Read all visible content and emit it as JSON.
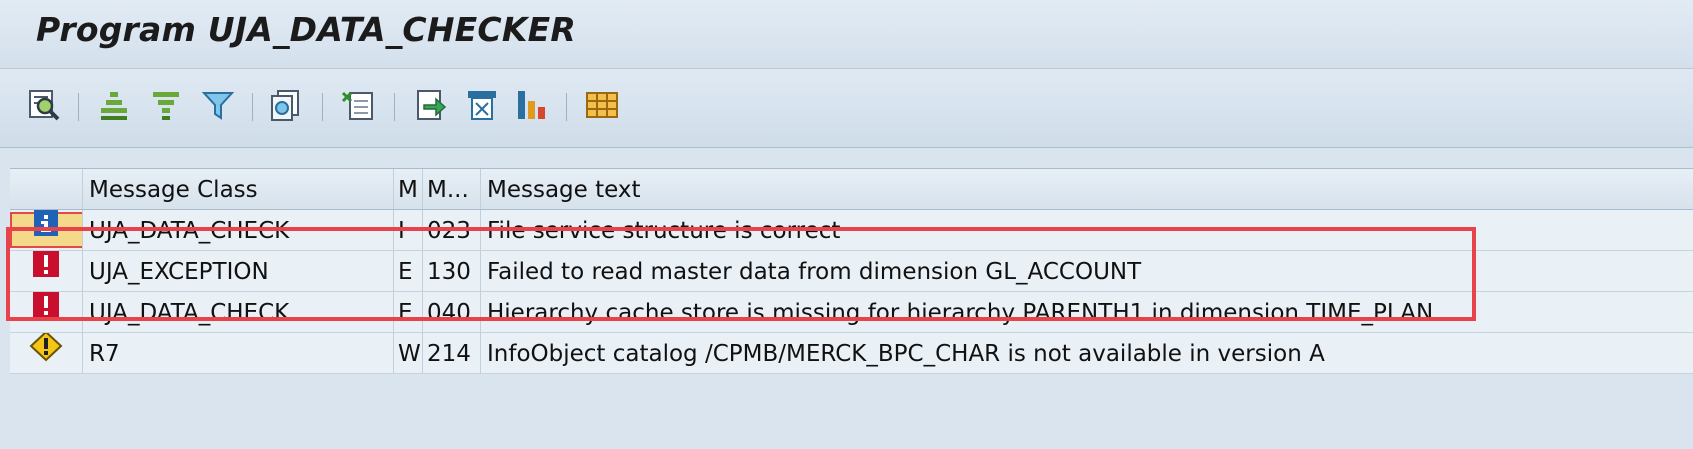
{
  "window": {
    "title": "Program UJA_DATA_CHECKER"
  },
  "toolbar": {
    "buttons": [
      {
        "icon": "detail-magnifier-icon"
      },
      {
        "icon": "sort-ascending-icon"
      },
      {
        "icon": "sort-descending-icon"
      },
      {
        "icon": "filter-icon"
      },
      {
        "icon": "print-preview-icon"
      },
      {
        "icon": "export-spreadsheet-icon"
      },
      {
        "icon": "export-file-icon"
      },
      {
        "icon": "select-layout-icon"
      },
      {
        "icon": "graphic-chart-icon"
      },
      {
        "icon": "change-layout-icon"
      }
    ]
  },
  "table": {
    "columns": [
      "",
      "Message Class",
      "M",
      "M...",
      "Message text"
    ],
    "rows": [
      {
        "type": "info",
        "icon": "info-icon",
        "message_class": "UJA_DATA_CHECK",
        "msg_type": "I",
        "msg_no": "023",
        "text": "File service structure is correct"
      },
      {
        "type": "error",
        "icon": "error-icon",
        "message_class": "UJA_EXCEPTION",
        "msg_type": "E",
        "msg_no": "130",
        "text": "Failed to read master data from dimension GL_ACCOUNT"
      },
      {
        "type": "error",
        "icon": "error-icon",
        "message_class": "UJA_DATA_CHECK",
        "msg_type": "E",
        "msg_no": "040",
        "text": "Hierarchy cache store is missing for hierarchy PARENTH1 in dimension TIME_PLAN"
      },
      {
        "type": "warning",
        "icon": "warning-icon",
        "message_class": "R7",
        "msg_type": "W",
        "msg_no": "214",
        "text": "InfoObject catalog /CPMB/MERCK_BPC_CHAR is not available in version A"
      }
    ]
  },
  "colors": {
    "error": "#c8102e",
    "warning": "#f5c518",
    "info": "#1f62b8",
    "highlight_box": "#e8434a"
  }
}
